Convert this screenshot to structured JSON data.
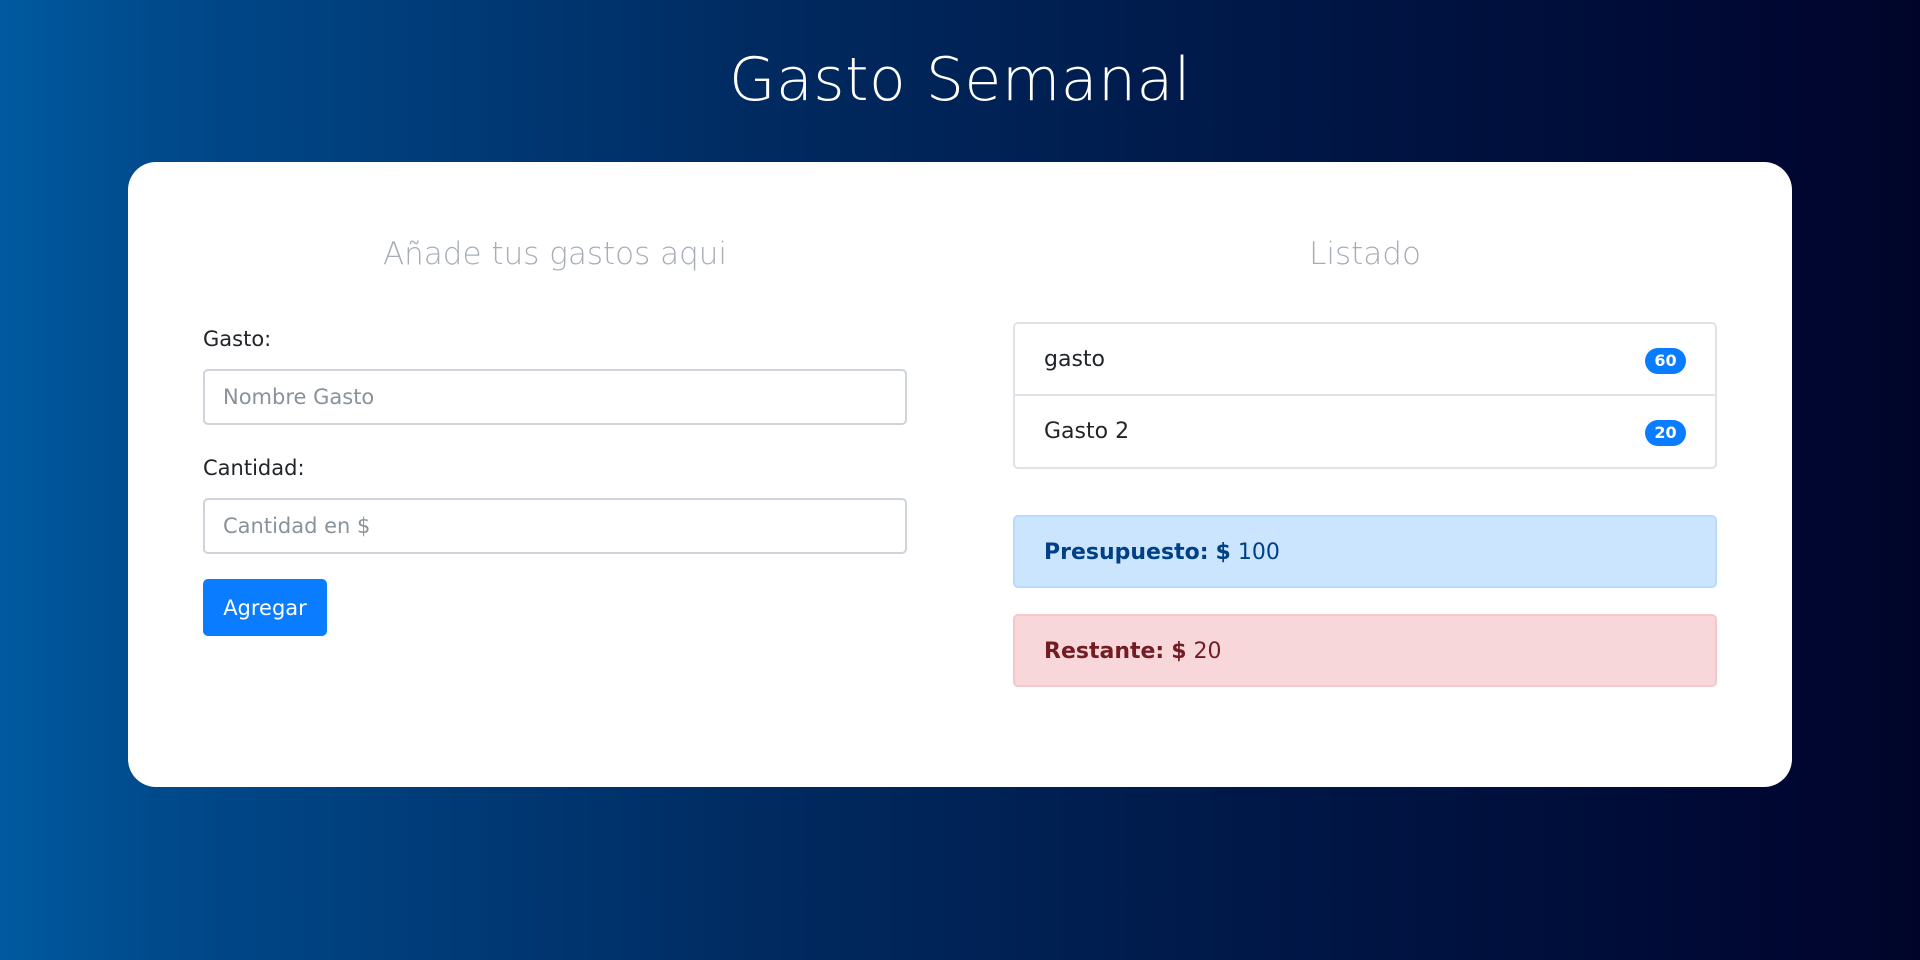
{
  "header": {
    "title": "Gasto Semanal"
  },
  "form": {
    "heading": "Añade tus gastos aqui",
    "gasto_label": "Gasto:",
    "gasto_placeholder": "Nombre Gasto",
    "gasto_value": "",
    "cantidad_label": "Cantidad:",
    "cantidad_placeholder": "Cantidad en $",
    "cantidad_value": "",
    "submit_label": "Agregar"
  },
  "listado": {
    "heading": "Listado",
    "items": [
      {
        "name": "gasto",
        "amount": "60"
      },
      {
        "name": "Gasto 2",
        "amount": "20"
      }
    ]
  },
  "presupuesto": {
    "label": "Presupuesto:",
    "currency": "$",
    "value": "100"
  },
  "restante": {
    "label": "Restante:",
    "currency": "$",
    "value": "20"
  },
  "colors": {
    "primary": "#0a7cff",
    "alert_primary_bg": "#cce5ff",
    "alert_danger_bg": "#f8d7da",
    "background_start": "#005aa0",
    "background_end": "#000528"
  }
}
